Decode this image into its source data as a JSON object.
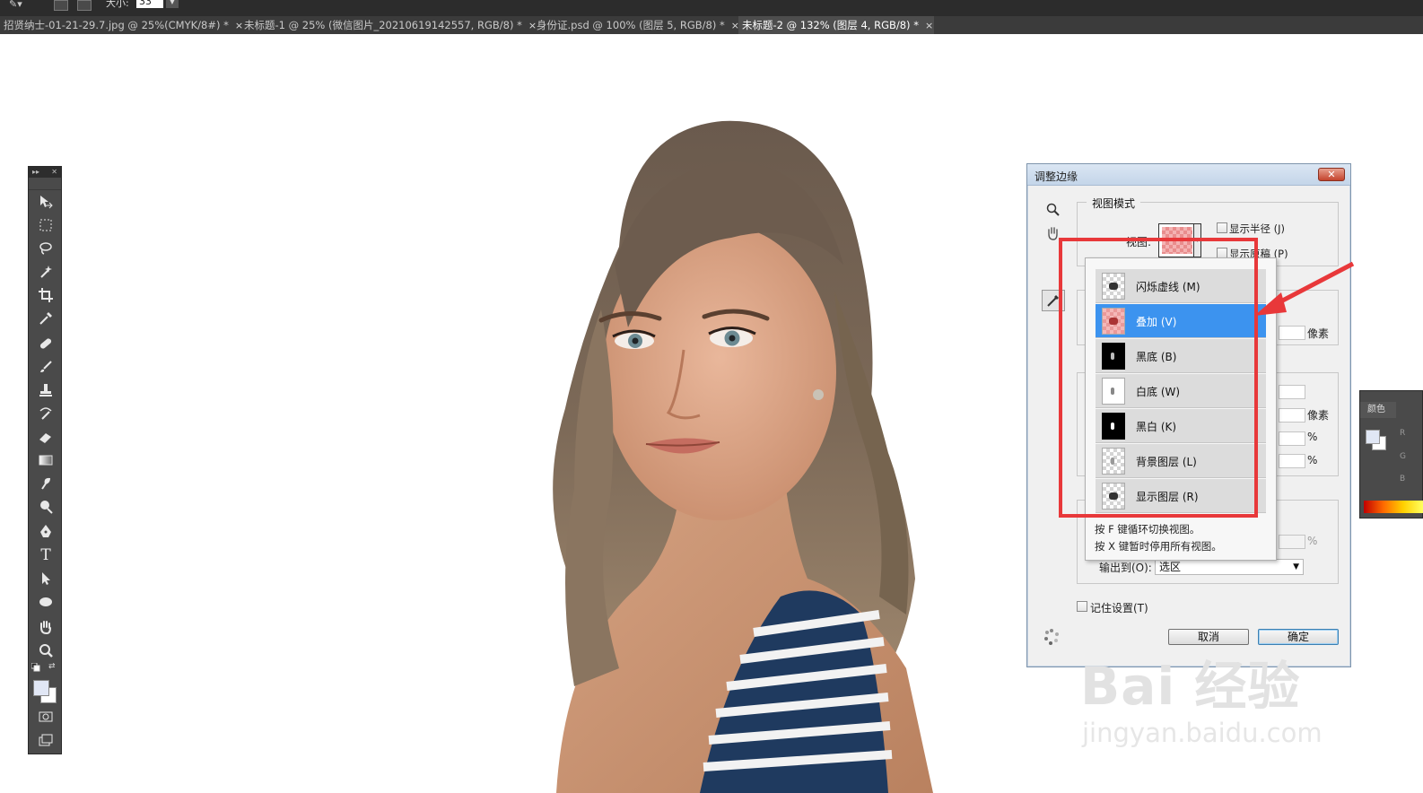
{
  "options_bar": {
    "size_label": "大小:",
    "size_value": "33"
  },
  "tabs": [
    {
      "label": "招贤纳士-01-21-29.7.jpg @ 25%(CMYK/8#) *",
      "close": "×"
    },
    {
      "label": "未标题-1 @ 25% (微信图片_20210619142557, RGB/8) *",
      "close": "×"
    },
    {
      "label": "身份证.psd @ 100% (图层 5, RGB/8) *",
      "close": "×"
    },
    {
      "label": "未标题-2 @ 132% (图层 4, RGB/8) *",
      "close": "×",
      "active": true
    }
  ],
  "toolbox": {
    "tools": [
      "move-tool-icon",
      "marquee-tool-icon",
      "lasso-tool-icon",
      "quick-selection-tool-icon",
      "crop-tool-icon",
      "eyedropper-tool-icon",
      "healing-brush-tool-icon",
      "brush-tool-icon",
      "clone-stamp-tool-icon",
      "history-brush-tool-icon",
      "eraser-tool-icon",
      "gradient-tool-icon",
      "smudge-tool-icon",
      "dodge-tool-icon",
      "pen-tool-icon",
      "type-tool-icon",
      "path-selection-tool-icon",
      "ellipse-tool-icon",
      "hand-tool-icon",
      "zoom-tool-icon"
    ],
    "type_glyph": "T",
    "foreground": "#e1e7f5",
    "background": "#ffffff"
  },
  "dialog": {
    "title": "调整边缘",
    "close": "✕",
    "view_mode_group": "视图模式",
    "view_label": "视图:",
    "show_radius": "显示半径 (J)",
    "show_original": "显示原稿 (P)",
    "view_modes": [
      {
        "label": "闪烁虚线 (M)",
        "thumb": "checker"
      },
      {
        "label": "叠加 (V)",
        "thumb": "pink",
        "selected": true
      },
      {
        "label": "黑底 (B)",
        "thumb": "black"
      },
      {
        "label": "白底 (W)",
        "thumb": "white"
      },
      {
        "label": "黑白 (K)",
        "thumb": "black"
      },
      {
        "label": "背景图层 (L)",
        "thumb": "checker"
      },
      {
        "label": "显示图层 (R)",
        "thumb": "checker"
      }
    ],
    "hint_1": "按 F 键循环切换视图。",
    "hint_2": "按 X 键暂时停用所有视图。",
    "unit_pixels_1": "像素",
    "unit_pixels_2": "像素",
    "unit_percent_1": "%",
    "unit_percent_2": "%",
    "unit_percent_3": "%",
    "output_label": "输出到(O):",
    "output_value": "选区",
    "remember_label": "记住设置(T)",
    "cancel": "取消",
    "ok": "确定"
  },
  "color_panel": {
    "tab": "颜色",
    "channels": [
      "R",
      "G",
      "B"
    ]
  },
  "annotation": {
    "highlight_color": "#e8383a"
  },
  "watermark": {
    "brand": "Bai 经验",
    "url": "jingyan.baidu.com"
  }
}
